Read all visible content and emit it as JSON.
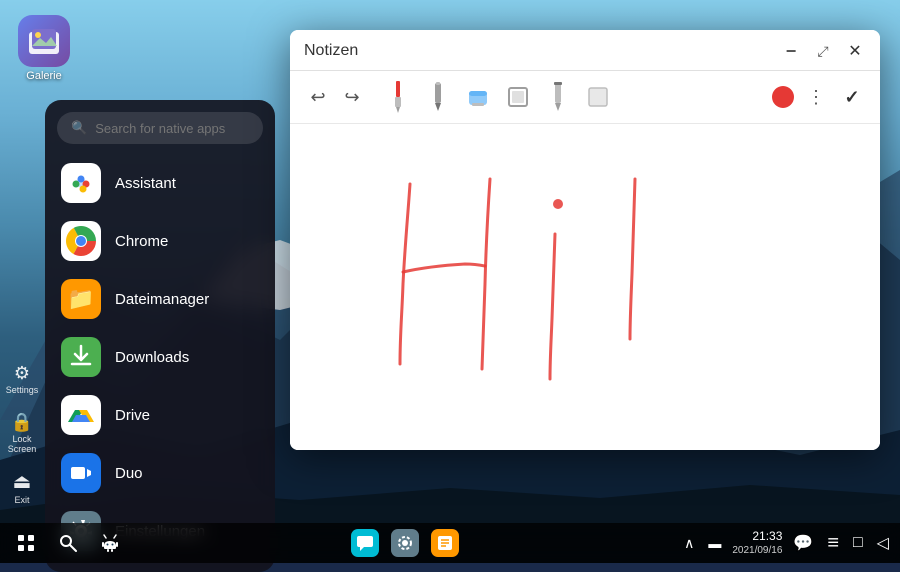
{
  "wallpaper": {
    "alt": "Mountain landscape wallpaper"
  },
  "gallery_icon": {
    "label": "Galerie"
  },
  "app_drawer": {
    "search_placeholder": "Search for native apps",
    "apps": [
      {
        "id": "assistant",
        "name": "Assistant",
        "icon_type": "assistant"
      },
      {
        "id": "chrome",
        "name": "Chrome",
        "icon_type": "chrome"
      },
      {
        "id": "dateimanager",
        "name": "Dateimanager",
        "icon_type": "filemanager"
      },
      {
        "id": "downloads",
        "name": "Downloads",
        "icon_type": "downloads"
      },
      {
        "id": "drive",
        "name": "Drive",
        "icon_type": "drive"
      },
      {
        "id": "duo",
        "name": "Duo",
        "icon_type": "duo"
      },
      {
        "id": "einstellungen",
        "name": "Einstellungen",
        "icon_type": "einstellungen"
      }
    ]
  },
  "notizen_window": {
    "title": "Notizen",
    "minimize_label": "−",
    "maximize_label": "⤢",
    "close_label": "✕",
    "toolbar": {
      "undo_icon": "↩",
      "redo_icon": "↪",
      "more_icon": "⋮",
      "check_icon": "✓"
    }
  },
  "left_sidebar": [
    {
      "id": "settings",
      "icon": "⚙",
      "label": "Settings"
    },
    {
      "id": "lock-screen",
      "icon": "🔒",
      "label": "Lock\nScreen"
    },
    {
      "id": "exit",
      "icon": "⏻",
      "label": "Exit"
    }
  ],
  "taskbar": {
    "left_buttons": [
      {
        "id": "grid",
        "icon": "⊞"
      },
      {
        "id": "search",
        "icon": "🔍"
      },
      {
        "id": "android",
        "icon": "🤖"
      }
    ],
    "apps": [
      {
        "id": "messaging",
        "color": "#00BCD4"
      },
      {
        "id": "settings2",
        "color": "#607D8B"
      },
      {
        "id": "notes",
        "color": "#FF9800"
      }
    ],
    "right": {
      "chevron": "∧",
      "battery": "▬",
      "time": "21:33",
      "date": "2021/09/16",
      "chat_icon": "💬",
      "menu_icon": "≡",
      "window_icon": "□",
      "back_icon": "◁"
    }
  }
}
